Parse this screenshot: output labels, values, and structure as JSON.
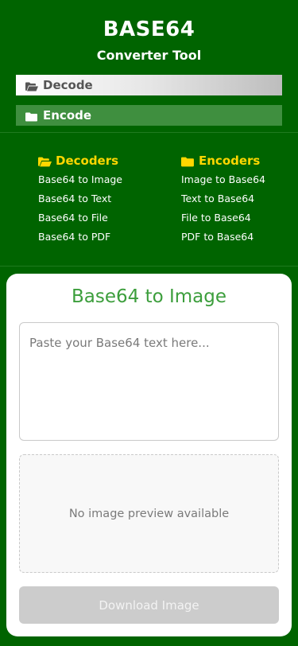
{
  "header": {
    "title": "BASE64",
    "subtitle": "Converter Tool"
  },
  "nav": {
    "decode_label": "Decode",
    "encode_label": "Encode"
  },
  "menu": {
    "decoders": {
      "heading": "Decoders",
      "items": [
        "Base64 to Image",
        "Base64 to Text",
        "Base64 to File",
        "Base64 to PDF"
      ]
    },
    "encoders": {
      "heading": "Encoders",
      "items": [
        "Image to Base64",
        "Text to Base64",
        "File to Base64",
        "PDF to Base64"
      ]
    }
  },
  "main": {
    "title": "Base64 to Image",
    "input": {
      "value": "",
      "placeholder": "Paste your Base64 text here..."
    },
    "preview_text": "No image preview available",
    "download_label": "Download Image"
  },
  "colors": {
    "background": "#006400",
    "accent_yellow": "#ffd700",
    "title_green": "#3c9e3c",
    "encode_button": "#3f8f3f",
    "disabled_button": "#cccccc"
  },
  "icons": {
    "decode": "folder-open-icon",
    "encode": "folder-icon",
    "decoders": "folder-open-icon",
    "encoders": "folder-icon"
  }
}
